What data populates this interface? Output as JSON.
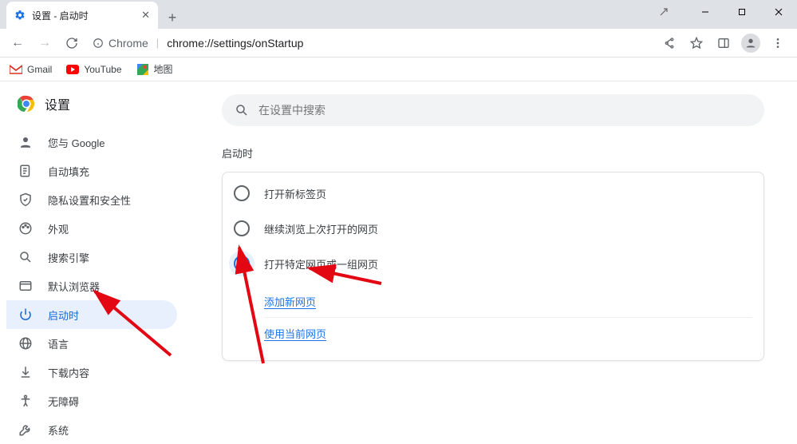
{
  "window": {
    "tab_title": "设置 - 启动时"
  },
  "toolbar": {
    "scheme_label": "Chrome",
    "url_display": "chrome://settings/onStartup"
  },
  "bookmarks": [
    {
      "label": "Gmail",
      "icon": "gmail"
    },
    {
      "label": "YouTube",
      "icon": "youtube"
    },
    {
      "label": "地图",
      "icon": "maps"
    }
  ],
  "page": {
    "title": "设置",
    "search_placeholder": "在设置中搜索"
  },
  "sidebar": {
    "items": [
      {
        "label": "您与 Google",
        "icon": "person"
      },
      {
        "label": "自动填充",
        "icon": "autofill"
      },
      {
        "label": "隐私设置和安全性",
        "icon": "shield"
      },
      {
        "label": "外观",
        "icon": "palette"
      },
      {
        "label": "搜索引擎",
        "icon": "search"
      },
      {
        "label": "默认浏览器",
        "icon": "browser"
      },
      {
        "label": "启动时",
        "icon": "power",
        "active": true
      },
      {
        "label": "语言",
        "icon": "globe"
      },
      {
        "label": "下载内容",
        "icon": "download"
      },
      {
        "label": "无障碍",
        "icon": "accessibility"
      },
      {
        "label": "系统",
        "icon": "wrench"
      }
    ]
  },
  "startup": {
    "section_title": "启动时",
    "options": [
      {
        "label": "打开新标签页",
        "selected": false
      },
      {
        "label": "继续浏览上次打开的网页",
        "selected": false
      },
      {
        "label": "打开特定网页或一组网页",
        "selected": true
      }
    ],
    "links": {
      "add_new_page": "添加新网页",
      "use_current": "使用当前网页"
    }
  }
}
